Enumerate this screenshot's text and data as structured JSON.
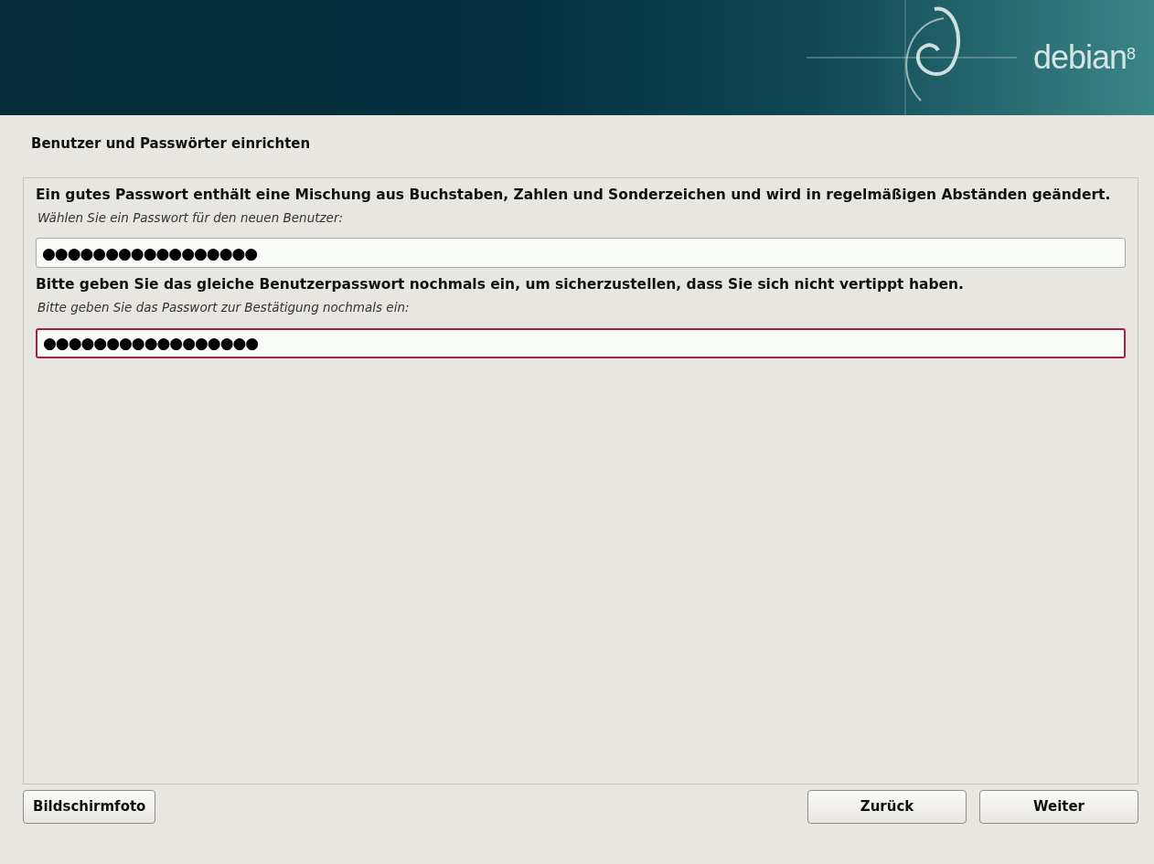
{
  "banner": {
    "logo_text": "debian",
    "version": "8"
  },
  "step_title": "Benutzer und Passwörter einrichten",
  "fields": [
    {
      "description": "Ein gutes Passwort enthält eine Mischung aus Buchstaben, Zahlen und Sonderzeichen und wird in regelmäßigen Abständen geändert.",
      "prompt": "Wählen Sie ein Passwort für den neuen Benutzer:",
      "value": "●●●●●●●●●●●●●●●●●",
      "focused": false
    },
    {
      "description": "Bitte geben Sie das gleiche Benutzerpasswort nochmals ein, um sicherzustellen, dass Sie sich nicht vertippt haben.",
      "prompt": "Bitte geben Sie das Passwort zur Bestätigung nochmals ein:",
      "value": "●●●●●●●●●●●●●●●●●",
      "focused": true
    }
  ],
  "buttons": [
    {
      "label": "Bildschirmfoto",
      "kind": "left"
    },
    {
      "label": "Zurück",
      "kind": "right"
    },
    {
      "label": "Weiter",
      "kind": "right"
    }
  ]
}
